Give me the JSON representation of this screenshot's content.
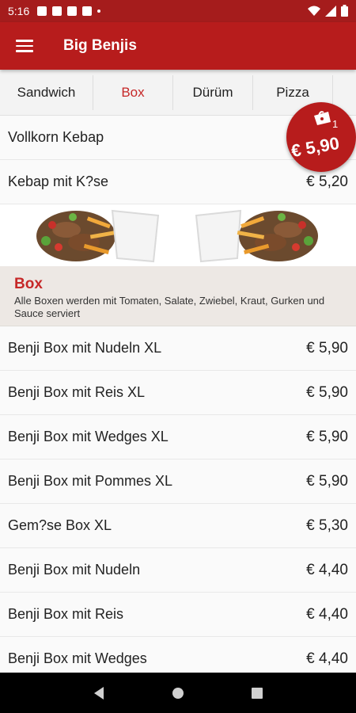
{
  "status": {
    "time": "5:16"
  },
  "app": {
    "title": "Big Benjis"
  },
  "tabs": [
    {
      "label": "Sandwich"
    },
    {
      "label": "Box"
    },
    {
      "label": "Dürüm"
    },
    {
      "label": "Pizza"
    }
  ],
  "top_items": [
    {
      "name": "Vollkorn Kebap",
      "price": ""
    },
    {
      "name": "Kebap mit K?se",
      "price": "€ 5,20"
    }
  ],
  "section": {
    "title": "Box",
    "description": "Alle Boxen werden mit Tomaten, Salate, Zwiebel, Kraut, Gurken und Sauce serviert"
  },
  "box_items": [
    {
      "name": "Benji Box mit Nudeln XL",
      "price": "€ 5,90"
    },
    {
      "name": "Benji Box mit Reis XL",
      "price": "€ 5,90"
    },
    {
      "name": "Benji Box mit Wedges XL",
      "price": "€ 5,90"
    },
    {
      "name": "Benji Box mit Pommes XL",
      "price": "€ 5,90"
    },
    {
      "name": "Gem?se Box XL",
      "price": "€ 5,30"
    },
    {
      "name": "Benji Box mit Nudeln",
      "price": "€ 4,40"
    },
    {
      "name": "Benji Box mit Reis",
      "price": "€ 4,40"
    },
    {
      "name": "Benji Box mit Wedges",
      "price": "€ 4,40"
    }
  ],
  "cart": {
    "count": "1",
    "total": "€ 5,90"
  },
  "colors": {
    "primary": "#b71c1c",
    "accent": "#c62828"
  }
}
